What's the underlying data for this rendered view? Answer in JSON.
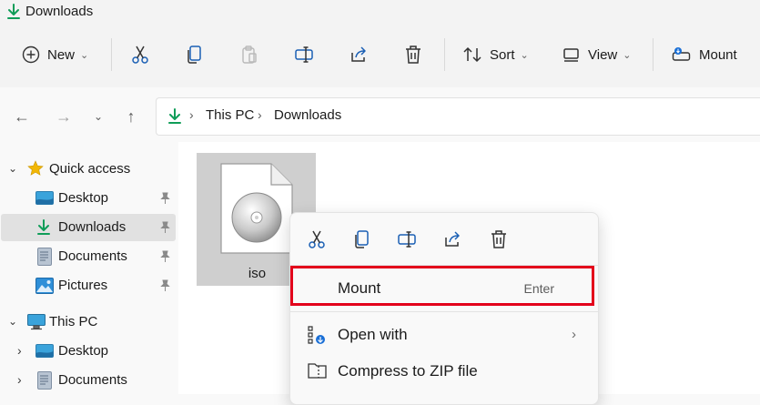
{
  "window": {
    "title": "Downloads"
  },
  "toolbar": {
    "new_label": "New",
    "sort_label": "Sort",
    "view_label": "View",
    "mount_label": "Mount"
  },
  "address": {
    "crumbs": [
      "This PC",
      "Downloads"
    ]
  },
  "sidebar": {
    "items": [
      {
        "label": "Quick access"
      },
      {
        "label": "Desktop"
      },
      {
        "label": "Downloads"
      },
      {
        "label": "Documents"
      },
      {
        "label": "Pictures"
      },
      {
        "label": "This PC"
      },
      {
        "label": "Desktop"
      },
      {
        "label": "Documents"
      }
    ]
  },
  "content": {
    "file": {
      "name": "iso"
    }
  },
  "context_menu": {
    "items": [
      {
        "label": "Mount",
        "shortcut": "Enter"
      },
      {
        "label": "Open with"
      },
      {
        "label": "Compress to ZIP file"
      }
    ]
  },
  "colors": {
    "highlight": "#e3001b",
    "download_green": "#0f9d58",
    "accent_blue": "#1a6fd6"
  }
}
